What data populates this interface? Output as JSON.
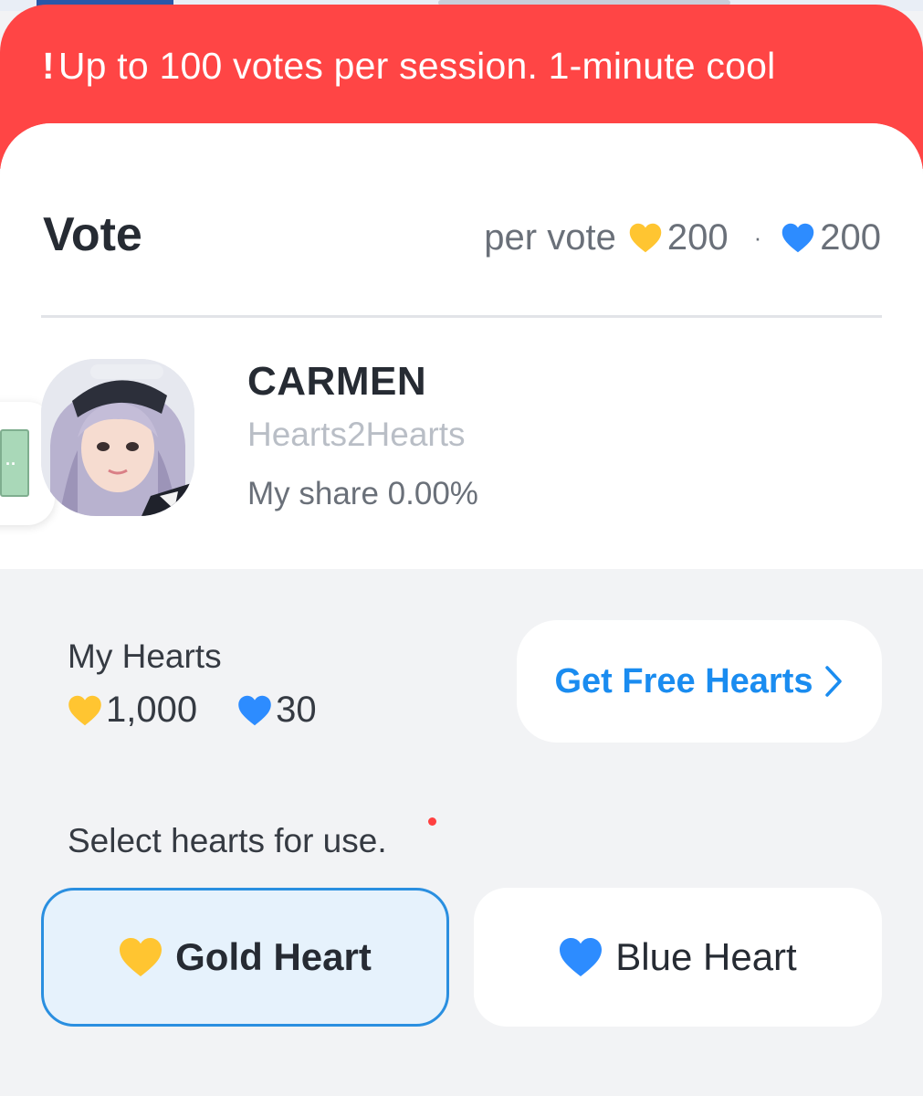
{
  "banner": {
    "icon": "exclamation-icon",
    "icon_glyph": "!",
    "text": "Up to 100 votes per session. 1-minute cool"
  },
  "vote": {
    "title": "Vote",
    "per_vote_label": "per vote",
    "gold_cost": "200",
    "separator": "·",
    "blue_cost": "200"
  },
  "candidate": {
    "name": "CARMEN",
    "group": "Hearts2Hearts",
    "share_label": "My share",
    "share_value": "0.00%"
  },
  "my_hearts": {
    "label": "My Hearts",
    "gold_balance": "1,000",
    "blue_balance": "30"
  },
  "free_hearts_button": {
    "label": "Get Free Hearts"
  },
  "select": {
    "label": "Select hearts for use.",
    "options": [
      {
        "label": "Gold Heart",
        "icon": "gold-heart-icon",
        "selected": true
      },
      {
        "label": "Blue Heart",
        "icon": "blue-heart-icon",
        "selected": false
      }
    ]
  },
  "colors": {
    "banner": "#ff4545",
    "gold_heart": "#ffc531",
    "blue_heart": "#2d8cff",
    "accent_link": "#1a8cf0",
    "selected_border": "#2a8fe0",
    "selected_bg": "#e6f2fc"
  }
}
